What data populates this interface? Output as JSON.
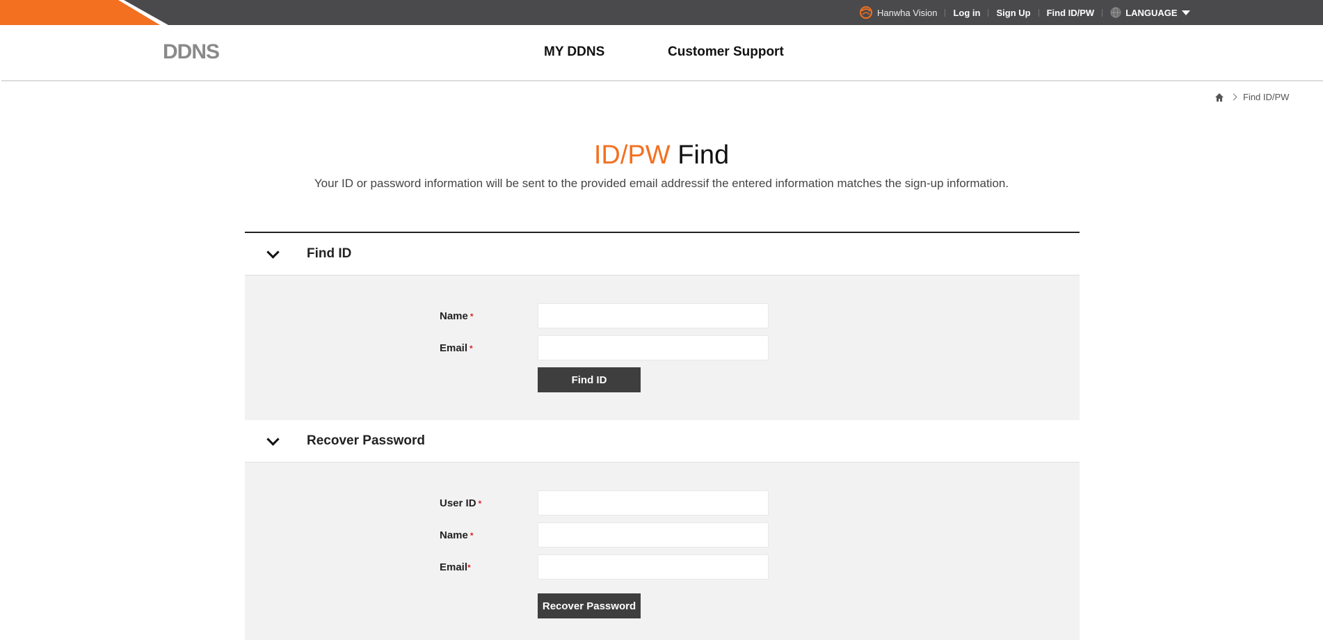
{
  "topbar": {
    "brand_text": "Hanwha Vision",
    "login": "Log in",
    "signup": "Sign Up",
    "find_idpw": "Find ID/PW",
    "language": "LANGUAGE",
    "accent_color": "#f37021"
  },
  "header": {
    "logo": "DDNS",
    "nav": [
      "MY DDNS",
      "Customer Support"
    ]
  },
  "breadcrumb": {
    "home_icon": "home-icon",
    "current": "Find ID/PW"
  },
  "page": {
    "title_accent": "ID/PW",
    "title_rest": " Find",
    "subtitle": "Your ID or password information will be sent to the provided email addressif the entered information matches the sign-up information."
  },
  "find_id": {
    "section_title": "Find ID",
    "name_label": "Name",
    "email_label": "Email",
    "required_mark": "*",
    "name_value": "",
    "email_value": "",
    "button": "Find ID"
  },
  "recover": {
    "section_title": "Recover Password",
    "userid_label": "User ID",
    "name_label": "Name",
    "email_label": "Email",
    "required_mark": "*",
    "userid_value": "",
    "name_value": "",
    "email_value": "",
    "button": "Recover Password"
  }
}
